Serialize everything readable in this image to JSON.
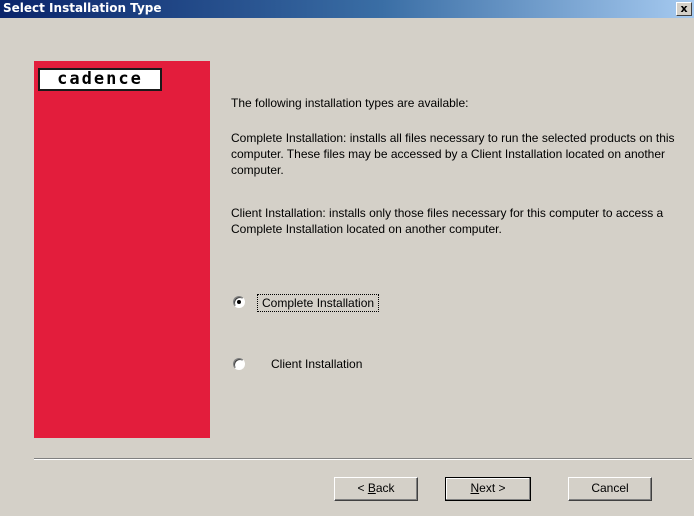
{
  "window": {
    "title": "Select Installation Type",
    "close_label": "x"
  },
  "logo": {
    "text": "cadence"
  },
  "content": {
    "intro": "The following installation types are available:",
    "complete_desc": "Complete Installation: installs all files necessary to run the selected products on this computer. These files may be accessed by a Client Installation located on another computer.",
    "client_desc": "Client Installation: installs only those files necessary for this computer to access a Complete Installation located on another computer."
  },
  "options": [
    {
      "label": "Complete Installation",
      "selected": true
    },
    {
      "label": "Client Installation",
      "selected": false
    }
  ],
  "buttons": {
    "back": {
      "prefix": "< ",
      "mnemonic": "B",
      "rest": "ack"
    },
    "next": {
      "mnemonic": "N",
      "rest": "ext >"
    },
    "cancel": "Cancel"
  },
  "colors": {
    "title_bar_start": "#0a246a",
    "title_bar_end": "#a6caf0",
    "dialog_bg": "#d4d0c8",
    "side_panel": "#e31d3c"
  }
}
